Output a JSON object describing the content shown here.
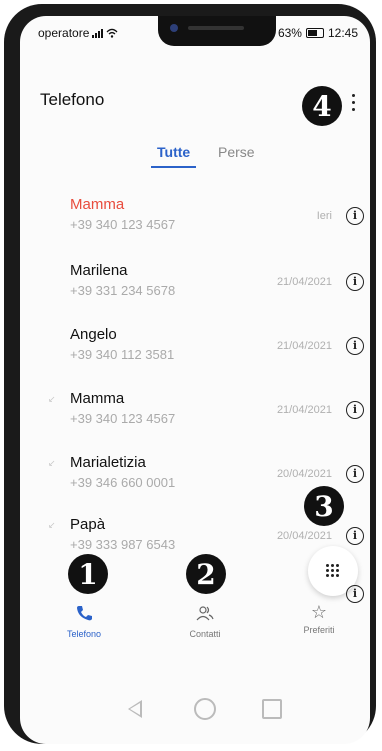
{
  "status": {
    "carrier": "operatore",
    "battery": "63%",
    "time": "12:45"
  },
  "app": {
    "title": "Telefono"
  },
  "tabs": [
    {
      "label": "Tutte",
      "active": true
    },
    {
      "label": "Perse",
      "active": false
    }
  ],
  "calls": [
    {
      "name": "Mamma",
      "number": "+39 340 123 4567",
      "date": "Ieri",
      "missed": true,
      "arrow": false
    },
    {
      "name": "Marilena",
      "number": "+39 331 234 5678",
      "date": "21/04/2021",
      "missed": false,
      "arrow": false
    },
    {
      "name": "Angelo",
      "number": "+39 340 112 3581",
      "date": "21/04/2021",
      "missed": false,
      "arrow": false
    },
    {
      "name": "Mamma",
      "number": "+39 340 123 4567",
      "date": "21/04/2021",
      "missed": false,
      "arrow": true
    },
    {
      "name": "Marialetizia",
      "number": "+39 346 660 0001",
      "date": "20/04/2021",
      "missed": false,
      "arrow": true
    },
    {
      "name": "Papà",
      "number": "+39 333 987 6543",
      "date": "20/04/2021",
      "missed": false,
      "arrow": true
    }
  ],
  "markers": [
    "4",
    "3",
    "1",
    "2"
  ],
  "nav": [
    {
      "label": "Telefono",
      "icon": "phone-icon",
      "active": true
    },
    {
      "label": "Contatti",
      "icon": "contacts-icon",
      "active": false
    },
    {
      "label": "Preferiti",
      "icon": "star-icon",
      "active": false
    }
  ],
  "colors": {
    "accent": "#2b62c9",
    "missed": "#e84c3d"
  },
  "glyphs": {
    "info": "i",
    "arrow": "↙",
    "star": "☆"
  }
}
